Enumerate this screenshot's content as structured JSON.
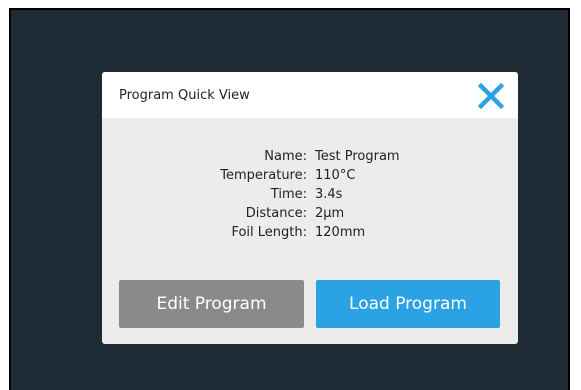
{
  "dialog": {
    "title": "Program Quick View",
    "close_icon": "close-x-icon",
    "accent_color": "#2ba2e3"
  },
  "details": [
    {
      "label": "Name:",
      "value": "Test Program"
    },
    {
      "label": "Temperature:",
      "value": "110°C"
    },
    {
      "label": "Time:",
      "value": "3.4s"
    },
    {
      "label": "Distance:",
      "value": "2µm"
    },
    {
      "label": "Foil Length:",
      "value": "120mm"
    }
  ],
  "buttons": {
    "edit_label": "Edit Program",
    "load_label": "Load Program"
  },
  "colors": {
    "background": "#1f2b34",
    "edit_button": "#8a8a8a",
    "load_button": "#2ba2e3"
  }
}
